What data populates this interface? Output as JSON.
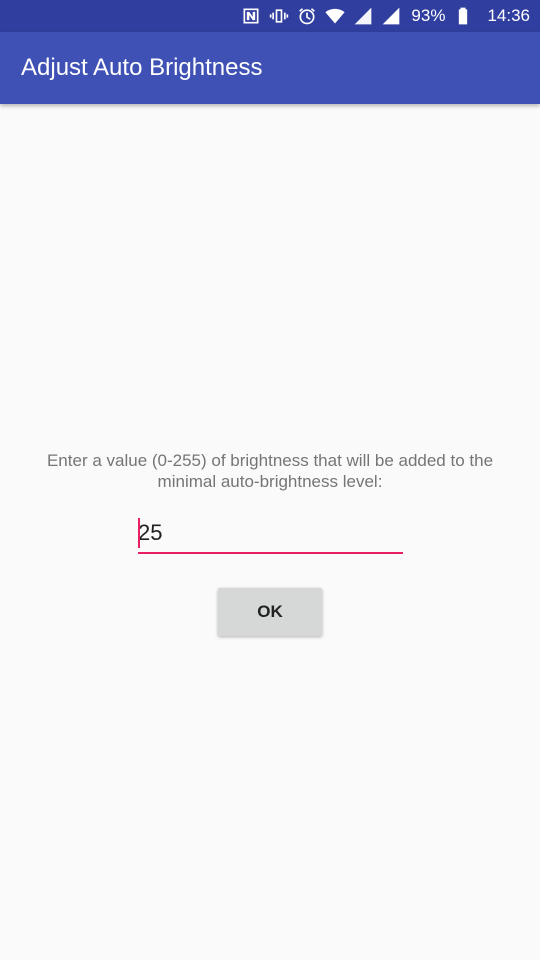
{
  "status_bar": {
    "battery_percent": "93%",
    "time": "14:36",
    "icons": [
      "nfc-icon",
      "vibrate-icon",
      "alarm-icon",
      "wifi-icon",
      "signal-icon",
      "signal-icon",
      "battery-icon"
    ],
    "background": "#303f9f"
  },
  "app_bar": {
    "title": "Adjust Auto Brightness",
    "background": "#3f51b5"
  },
  "dialog": {
    "prompt": "Enter a value (0-255) of brightness that will be added to the minimal auto-brightness level:",
    "input_value": "25",
    "ok_label": "OK",
    "accent_color": "#e91e63"
  }
}
